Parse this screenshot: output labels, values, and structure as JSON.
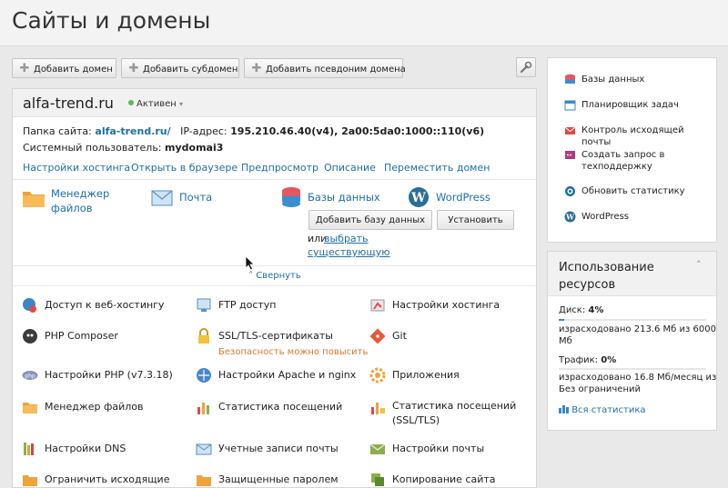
{
  "page_title": "Сайты и домены",
  "toolbar": {
    "add_domain": "Добавить домен",
    "add_subdomain": "Добавить субдомен",
    "add_alias": "Добавить псевдоним домена"
  },
  "domain": {
    "name": "alfa-trend.ru",
    "status": "Активен",
    "site_folder_label": "Папка сайта:",
    "site_folder_value": "alfa-trend.ru/",
    "ip_label": "IP-адрес:",
    "ip_value": "195.210.46.40(v4), 2a00:5da0:1000::110(v6)",
    "sysuser_label": "Системный пользователь:",
    "sysuser_value": "mydomai3",
    "links": [
      "Настройки хостинга",
      "Открыть в браузере",
      "Предпросмотр",
      "Описание",
      "Переместить домен"
    ],
    "quick": {
      "file_manager": "Менеджер\nфайлов",
      "mail": "Почта",
      "databases": "Базы данных",
      "wordpress": "WordPress",
      "add_db_button": "Добавить базу данных",
      "install_button": "Установить",
      "or_text": "или",
      "choose_existing_1": "выбрать",
      "choose_existing_2": "существующую"
    },
    "collapse": "Свернуть",
    "grid": [
      {
        "label": "Доступ к веб-хостингу"
      },
      {
        "label": "FTP доступ"
      },
      {
        "label": "Настройки хостинга"
      },
      {
        "label": "PHP Composer"
      },
      {
        "label": "SSL/TLS-сертификаты",
        "sub": "Безопасность можно повысить"
      },
      {
        "label": "Git"
      },
      {
        "label": "Настройки PHP (v7.3.18)"
      },
      {
        "label": "Настройки Apache и nginx"
      },
      {
        "label": "Приложения"
      },
      {
        "label": "Менеджер файлов"
      },
      {
        "label": "Статистика посещений"
      },
      {
        "label": "Статистика посещений\n(SSL/TLS)"
      },
      {
        "label": "Настройки DNS"
      },
      {
        "label": "Учетные записи почты"
      },
      {
        "label": "Настройки почты"
      },
      {
        "label": "Ограничить исходящие"
      },
      {
        "label": "Защищенные паролем"
      },
      {
        "label": "Копирование сайта"
      }
    ]
  },
  "sidebar": {
    "items": [
      {
        "label": "Базы данных"
      },
      {
        "label": "Планировщик задач"
      },
      {
        "label": "Контроль исходящей почты"
      },
      {
        "label": "Создать запрос в\nтехподдержку"
      },
      {
        "label": "Обновить статистику"
      },
      {
        "label": "WordPress"
      }
    ]
  },
  "resources": {
    "title": "Использование\nресурсов",
    "disk_label": "Диск:",
    "disk_value": "4%",
    "disk_percent": 4,
    "disk_used": "израсходовано 213.6 Мб из 6000\nМб",
    "traffic_label": "Трафик:",
    "traffic_value": "0%",
    "traffic_percent": 0,
    "traffic_used": "израсходовано 16.8 Мб/месяц из\nБез ограничений",
    "all_stats": "Вся статистика"
  },
  "colors": {
    "link": "#1f6fa6",
    "active": "#5cb85c",
    "warning": "#d9772b"
  }
}
